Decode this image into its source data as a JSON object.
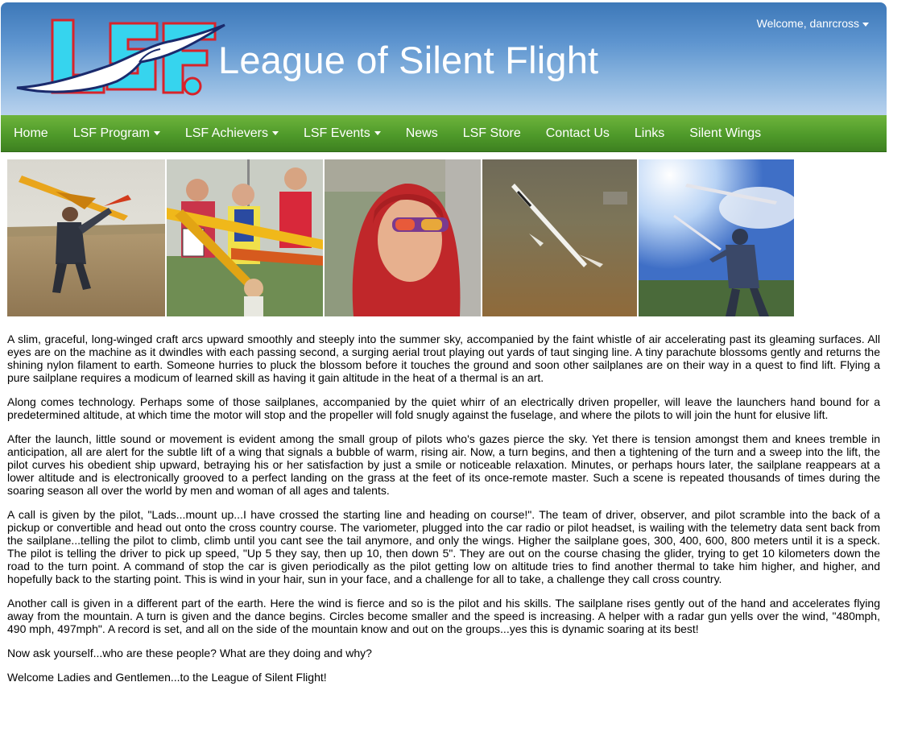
{
  "header": {
    "logo_alt": "LSF logo",
    "site_title": "League of Silent Flight",
    "welcome_text": "Welcome, danrcross"
  },
  "nav": {
    "items": [
      {
        "label": "Home",
        "dropdown": false
      },
      {
        "label": "LSF Program",
        "dropdown": true
      },
      {
        "label": "LSF Achievers",
        "dropdown": true
      },
      {
        "label": "LSF Events",
        "dropdown": true
      },
      {
        "label": "News",
        "dropdown": false
      },
      {
        "label": "LSF Store",
        "dropdown": false
      },
      {
        "label": "Contact Us",
        "dropdown": false
      },
      {
        "label": "Links",
        "dropdown": false
      },
      {
        "label": "Silent Wings",
        "dropdown": false
      }
    ]
  },
  "colors": {
    "header_blue": "#5d94cf",
    "nav_green": "#4f9a2a",
    "logo_cyan": "#36d4ee",
    "logo_red": "#d8232a"
  },
  "photos": [
    {
      "subject": "pilot launching yellow glider over field"
    },
    {
      "subject": "group of pilots with trophy glider"
    },
    {
      "subject": "boy in red hoodie with sunglasses"
    },
    {
      "subject": "sailplane in flight close to ground"
    },
    {
      "subject": "pilot launching glider into blue sky"
    }
  ],
  "content": {
    "paragraphs": [
      "A slim, graceful, long-winged craft arcs upward smoothly and steeply into the summer sky, accompanied by the faint whistle of air accelerating past its gleaming surfaces. All eyes are on the machine as it dwindles with each passing second, a surging aerial trout playing out yards of taut singing line. A tiny parachute blossoms gently and returns the shining nylon filament to earth. Someone hurries to pluck the blossom before it touches the ground and soon other sailplanes are on their way in a quest to find lift. Flying a pure sailplane requires a modicum of learned skill as having it gain altitude in the heat of a thermal is an art.",
      "Along comes technology. Perhaps some of those sailplanes, accompanied by the quiet whirr of an electrically driven propeller, will leave the launchers hand bound for a predetermined altitude, at which time the motor will stop and the propeller will fold snugly against the fuselage, and where the pilots to will join the hunt for elusive lift.",
      "After the launch, little sound or movement is evident among the small group of pilots who's gazes pierce the sky. Yet there is tension amongst them and knees tremble in anticipation, all are alert for the subtle lift of a wing that signals a bubble of warm, rising air. Now, a turn begins, and then a tightening of the turn and a sweep into the lift, the pilot curves his obedient ship upward, betraying his or her satisfaction by just a smile or noticeable relaxation. Minutes, or perhaps hours later, the sailplane reappears at a lower altitude and is electronically grooved to a perfect landing on the grass at the feet of its once-remote master. Such a scene is repeated thousands of times during the soaring season all over the world by men and woman of all ages and talents.",
      "A call is given by the pilot, \"Lads...mount up...I have crossed the starting line and heading on course!\". The team of driver, observer, and pilot scramble into the back of a pickup or convertible and head out onto the cross country course. The variometer, plugged into the car radio or pilot headset, is wailing with the telemetry data sent back from the sailplane...telling the pilot to climb, climb until you cant see the tail anymore, and only the wings. Higher the sailplane goes, 300, 400, 600, 800 meters until it is a speck. The pilot is telling the driver to pick up speed, \"Up 5 they say, then up 10, then down 5\". They are out on the course chasing the glider, trying to get 10 kilometers down the road to the turn point. A command of stop the car is given periodically as the pilot getting low on altitude tries to find another thermal to take him higher, and higher, and hopefully back to the starting point. This is wind in your hair, sun in your face, and a challenge for all to take, a challenge they call cross country.",
      "Another call is given in a different part of the earth. Here the wind is fierce and so is the pilot and his skills. The sailplane rises gently out of the hand and accelerates flying away from the mountain. A turn is given and the dance begins. Circles become smaller and the speed is increasing. A helper with a radar gun yells over the wind, \"480mph, 490 mph, 497mph\". A record is set, and all on the side of the mountain know and out on the groups...yes this is dynamic soaring at its best!",
      "Now ask yourself...who are these people? What are they doing and why?",
      "Welcome Ladies and Gentlemen...to the League of Silent Flight!"
    ]
  }
}
